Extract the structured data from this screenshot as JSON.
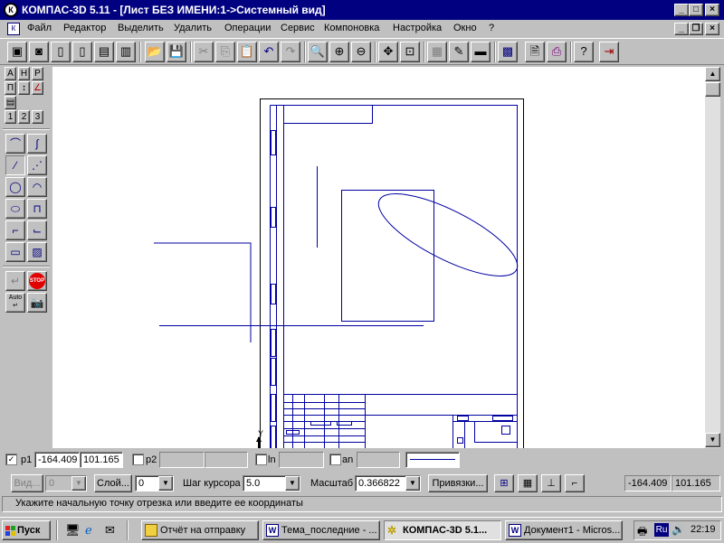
{
  "window": {
    "title": "КОМПАС-3D 5.11 - [Лист БЕЗ ИМЕНИ:1->Системный вид]",
    "app_icon": "К"
  },
  "menu": [
    "Файл",
    "Редактор",
    "Выделить",
    "Удалить",
    "Операции",
    "Сервис",
    "Компоновка",
    "Настройка",
    "Окно",
    "?"
  ],
  "left_panel": {
    "small_labels": [
      "1",
      "2",
      "3"
    ]
  },
  "status": {
    "p1_label": "p1",
    "p1_x": "-164.409",
    "p1_y": "101.165",
    "p2_label": "p2",
    "ln_label": "ln",
    "an_label": "an"
  },
  "params": {
    "vid_label": "Вид...",
    "vid_value": "0",
    "layer_label": "Слой...",
    "layer_value": "0",
    "step_label": "Шаг курсора",
    "step_value": "5.0",
    "scale_label": "Масштаб",
    "scale_value": "0.366822",
    "snap_label": "Привязки...",
    "cursor_x": "-164.409",
    "cursor_y": "101.165"
  },
  "hint": "Укажите начальную точку отрезка или введите ее координаты",
  "taskbar": {
    "start_label": "Пуск",
    "tasks": [
      {
        "label": "Отчёт на отправку"
      },
      {
        "label": "Тема_последние - ..."
      },
      {
        "label": "КОМПАС-3D 5.1..."
      },
      {
        "label": "Документ1 - Micros..."
      }
    ],
    "lang": "Ru",
    "clock": "22:19"
  },
  "colors": {
    "drawing_line": "#0000a0",
    "title_bar": "#000080"
  }
}
